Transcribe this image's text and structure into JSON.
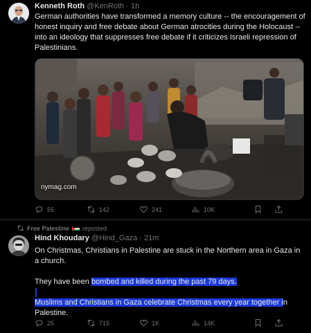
{
  "tweets": [
    {
      "author": "Kenneth Roth",
      "handle": "@KenRoth",
      "time": "1h",
      "text": "German authorities have transformed a memory culture -- the encouragement of honest inquiry and free debate about German atrocities during the Holocaust -- into an ideology that suppresses free debate if it criticizes Israeli repression of Palestinians.",
      "media": {
        "source": "nymag.com"
      },
      "stats": {
        "replies": "55",
        "reposts": "142",
        "likes": "241",
        "views": "10K"
      }
    },
    {
      "repost_by": "Free Palestine",
      "repost_label": "reposted",
      "author": "Hind Khoudary",
      "handle": "@Hind_Gaza",
      "time": "21m",
      "text_p1": "On Christmas, Christians in Palestine are stuck in the Northern area in Gaza in a church.",
      "text_p2_plain": "They have been ",
      "text_p2_hl": "bombed and killed during the past 79 days.",
      "text_p3_hl": "Muslims and Christians in Gaza celebrate Christmas every year together i",
      "text_p3_plain": "n Palestine.",
      "stats": {
        "replies": "25",
        "reposts": "715",
        "likes": "1K",
        "views": "14K"
      }
    }
  ],
  "icons": {
    "reply": "reply-icon",
    "repost": "repost-icon",
    "like": "heart-icon",
    "views": "views-icon",
    "bookmark": "bookmark-icon",
    "share": "share-icon"
  },
  "colors": {
    "background": "#000000",
    "text": "#e7e9ea",
    "muted": "#71767b",
    "divider": "#2f3336",
    "selection": "#1d3ad6"
  }
}
